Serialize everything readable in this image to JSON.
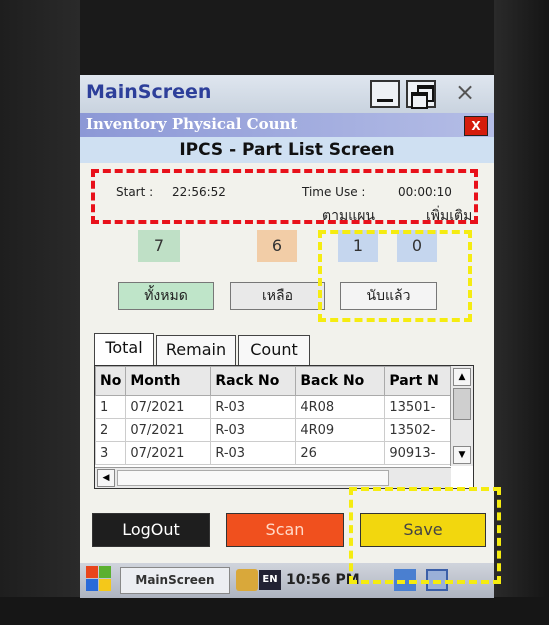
{
  "window": {
    "title": "MainScreen",
    "close_glyph": "×"
  },
  "app": {
    "title": "Inventory Physical Count",
    "close_label": "X",
    "screen_title": "IPCS - Part List Screen"
  },
  "info": {
    "start_label": "Start :",
    "start_time": "22:56:52",
    "timeuse_label": "Time Use :",
    "timeuse_value": "00:00:10",
    "plan_label": "ตามแผน",
    "extra_label": "เพิ่มเติม"
  },
  "counters": {
    "all": "7",
    "remaining": "6",
    "plan_counted": "1",
    "extra_counted": "0"
  },
  "filter_buttons": {
    "all": "ทั้งหมด",
    "remaining": "เหลือ",
    "counted": "นับแล้ว"
  },
  "tabs": [
    "Total",
    "Remain",
    "Count"
  ],
  "table": {
    "columns": [
      "No",
      "Month",
      "Rack No",
      "Back No",
      "Part N"
    ],
    "rows": [
      [
        "1",
        "07/2021",
        "R-03",
        "4R08",
        "13501-"
      ],
      [
        "2",
        "07/2021",
        "R-03",
        "4R09",
        "13502-"
      ],
      [
        "3",
        "07/2021",
        "R-03",
        "26",
        "90913-"
      ]
    ]
  },
  "actions": {
    "logout": "LogOut",
    "scan": "Scan",
    "save": "Save"
  },
  "taskbar": {
    "app_button": "MainScreen",
    "lang": "EN",
    "clock": "10:56 PM"
  },
  "colors": {
    "annotation_red": "#e8111a",
    "annotation_yellow": "#f5ec10",
    "scan_button": "#f0501e",
    "save_button": "#f2d70e"
  }
}
